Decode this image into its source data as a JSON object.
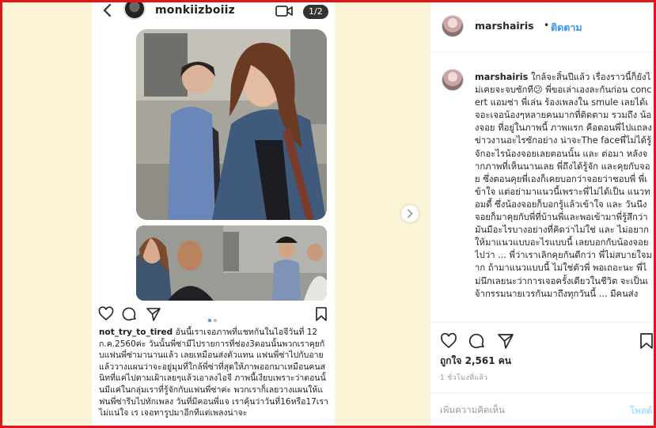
{
  "colors": {
    "border": "#e0161b",
    "background": "#fbf4d6",
    "link": "#3897f0",
    "text": "#262626",
    "muted": "#999999"
  },
  "media": {
    "phone": {
      "username": "monkiizboiiz",
      "page_indicator": "1/2",
      "back_icon": "chevron-left-icon",
      "video_icon": "video-camera-icon",
      "caption_user": "not_try_to_tired",
      "caption_text": "อันนี้เราเจอภาพที่แชทกันในไอจีวันที่ 12 ก.ค.2560ค่ะ วันนั้นพี่ซ่ามีไปรายการที่ช่อง3ตอนนั้นพวกเราคุยกับแฟนพี่ซ่ามานานแล้ว เลยเหมือนส่งตัวแทน แฟนพี่ซ่าไปกับอายแล้ววางแผนว่าจะอยู่มุมที่ใกล้พี่ซ่าที่สุดให้ภาพออกมาเหมือนคนสนิทที่แค่ไปตามเฝ้าเลยๆแล้วเอาลงไอจี ภาพนี้เงียบเพราะว่าตอนนั้นมีแค่ในกลุ่มเราที่รู้จักกับแฟนพี่ซ่าค่ะ พวกเราก็เลยวางแผนให้แฟนพี่ซ่ารีบไปทักเพลง วันที่มีคอนพี่แจ เราคุ้นว่าวันที่16หรือ17เราไม่แน่ใจ เร เจอทารูปมาอีกทีแต่เพลงน่าจะ"
    },
    "next_icon": "chevron-right-icon"
  },
  "panel": {
    "username": "marshairis",
    "dot": "•",
    "follow_label": "ติดตาม",
    "comment_user": "marshairis",
    "comment_text": "ใกล้จะสิ้นปีแล้ว เรื่องราวนี้ก็ยังไม่เคยจะจบซักที😕 พี่ขอเล่าเองละกันก่อน concert แอมซ่า พี่เล่น ร้องเพลงใน smule เลยได้เจอะเจอน้องๆหลายคนมากที่ติดตาม รวมถึง น้องจอย ที่อยู่ในภาพนี้ ภาพแรก คือตอนพี่ไปแถลงข่าวงานอะไรซักอย่าง น่าจะThe faceพี่ไม่ได้รู้จักอะไรน้องจอยเลยตอนนั้น และ ต่อมา หลังจากภาพที่เห็นนานเลย พี่ถึงได้รู้จัก และคุยกับจอย ซึ่งตอนคุยพี่เองก็เคยบอกว่าจอยว่าชอบพี่ พี่เข้าใจ แต่อย่ามาแนวนี้เพราะพี่ไม่ได้เป็น แนวทอมดี้ ซึ่งน้องจอยก็บอกรู้แล้วเข้าใจ และ วันนึงจอยก็มาคุยกับพี่ที่บ้านพี่และพอเข้ามาพี่รู้สึกว่ามันมีอะไรบางอย่างที่คิดว่าไม่ใช่ และ ไม่อยากให้มาแนวแบบอะไรแบบนี้ เลยบอกกับน้องจอยไปว่า ... พี่ว่าเราเลิกคุยกันดีกว่า พี่ไม่สบายใจมาก ถ้ามาแนวแบบนี้ ไม่ใช่ตัวพี่ พอเถอะนะ พี่ไม่นึกเลยนะว่าการเจอครั้งเดียวในชีวิต จะเป็นเจ้ากรรมนายเวรกันมาถึงทุกวันนี้ ... มีคนส่ง",
    "likes": "ถูกใจ 2,561 คน",
    "time": "1 ชั่วโมงที่แล้ว",
    "add_comment_placeholder": "เพิ่มความคิดเห็น",
    "post_label": "โพสต์",
    "icons": {
      "like": "heart-icon",
      "comment": "comment-bubble-icon",
      "share": "paper-plane-icon",
      "save": "bookmark-icon"
    }
  }
}
